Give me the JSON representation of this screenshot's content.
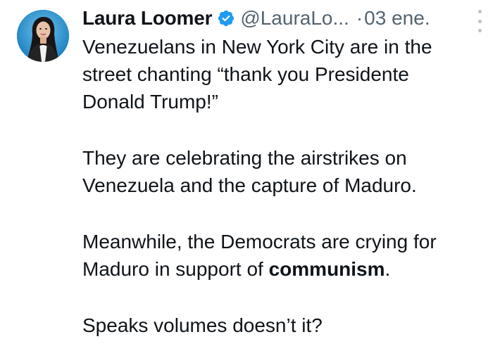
{
  "tweet": {
    "author_name": "Laura Loomer",
    "author_handle": "@LauraLo...",
    "separator": "·",
    "date": "03 ene.",
    "verified_color": "#1d9bf0",
    "paragraphs": [
      {
        "lines": [
          "Venezuelans in New York City are in the",
          "street chanting “thank you Presidente",
          "Donald Trump!”"
        ]
      },
      {
        "lines": [
          "They are celebrating the airstrikes on",
          "Venezuela and the capture of Maduro."
        ]
      },
      {
        "line1": "Meanwhile, the Democrats are crying for",
        "line2_prefix": "Maduro in support of ",
        "line2_link": "communism",
        "line2_suffix": "."
      },
      {
        "lines": [
          "Speaks volumes doesn’t it?"
        ]
      }
    ],
    "icons": {
      "avatar": "avatar",
      "verified": "verified-badge-icon",
      "more": "more-vertical-icon"
    }
  }
}
